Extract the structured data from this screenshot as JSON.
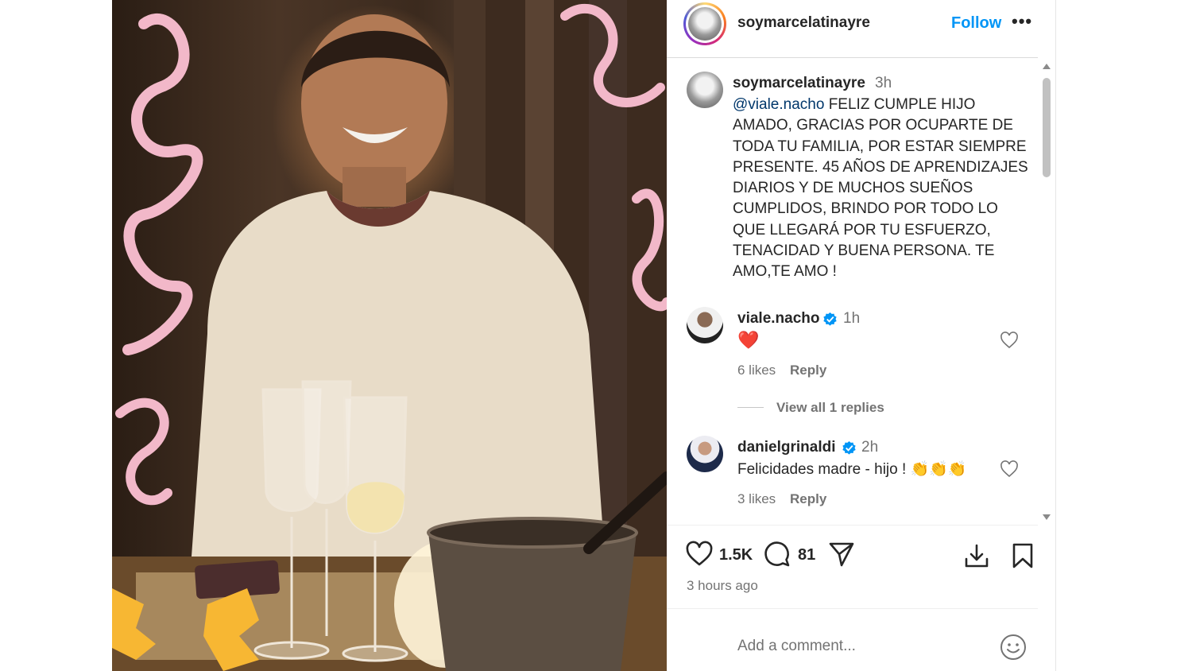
{
  "post": {
    "username": "soymarcelatinayre",
    "follow_label": "Follow",
    "more_label": "•••"
  },
  "caption": {
    "username": "soymarcelatinayre",
    "time": "3h",
    "mention": "@viale.nacho",
    "text": " FELIZ CUMPLE HIJO AMADO, GRACIAS POR OCUPARTE DE TODA TU FAMILIA, POR ESTAR SIEMPRE PRESENTE. 45 AÑOS DE APRENDIZAJES DIARIOS Y DE MUCHOS SUEÑOS CUMPLIDOS, BRINDO POR TODO LO QUE LLEGARÁ POR TU ESFUERZO, TENACIDAD Y BUENA PERSONA. TE AMO,TE AMO !"
  },
  "comments": [
    {
      "username": "viale.nacho",
      "verified": true,
      "time": "1h",
      "text": "❤️",
      "likes": "6 likes",
      "reply_label": "Reply",
      "view_replies": "View all 1 replies"
    },
    {
      "username": "danielgrinaldi",
      "verified": true,
      "time": "2h",
      "text": "Felicidades madre - hijo ! 👏👏👏",
      "likes": "3 likes",
      "reply_label": "Reply"
    }
  ],
  "actions": {
    "like_count": "1.5K",
    "comment_count": "81",
    "time_ago": "3 hours ago"
  },
  "add_comment": {
    "placeholder": "Add a comment..."
  },
  "icons": {
    "like": "heart-icon",
    "comment": "comment-icon",
    "share": "share-icon",
    "save": "bookmark-icon",
    "download": "download-icon",
    "emoji": "emoji-icon",
    "verified": "verified-badge-icon"
  },
  "colors": {
    "accent": "#0095f6",
    "verified": "#0095f6",
    "heart_red": "#ed1c24",
    "text": "#262626",
    "muted": "#737373"
  }
}
